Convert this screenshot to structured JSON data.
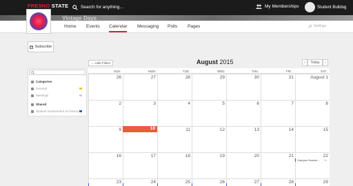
{
  "topbar": {
    "brand_red": "FRESNO",
    "brand_white": " STATE",
    "search_placeholder": "Search for anything...",
    "memberships_label": "My Memberships",
    "user_name": "Student Bulldog"
  },
  "org": {
    "banner_title": "Vintage Days"
  },
  "nav": {
    "home": "Home",
    "events": "Events",
    "calendar": "Calendar",
    "messaging": "Messaging",
    "polls": "Polls",
    "pages": "Pages",
    "settings": "Settings"
  },
  "toolbar": {
    "subscribe": "Subscribe",
    "hide_filters": "← Hide Filters",
    "month_bold": "August",
    "year": " 2015",
    "prev": "‹",
    "today": "Today",
    "next": "›"
  },
  "filters": {
    "categories": "Categories",
    "general": "General",
    "meetings": "Meetings",
    "shared": "Shared",
    "student_inv": "Student Involvement at Fresno..."
  },
  "days_of_week": [
    "SUN",
    "MON",
    "TUE",
    "WED",
    "THU",
    "FRI",
    "SAT"
  ],
  "weeks": [
    [
      "26",
      "27",
      "28",
      "29",
      "30",
      "31",
      "August 1"
    ],
    [
      "2",
      "3",
      "4",
      "5",
      "6",
      "7",
      "8"
    ],
    [
      "9",
      "10",
      "11",
      "12",
      "13",
      "14",
      "15"
    ],
    [
      "16",
      "17",
      "18",
      "19",
      "20",
      "21",
      "22"
    ],
    [
      "23",
      "24",
      "25",
      "26",
      "27",
      "28",
      "29"
    ]
  ],
  "event": {
    "label": "Campus Scaven...",
    "more": "%"
  },
  "colors": {
    "accent": "#d4243a",
    "today": "#e85d3c",
    "event_blue": "#3a57c4"
  }
}
